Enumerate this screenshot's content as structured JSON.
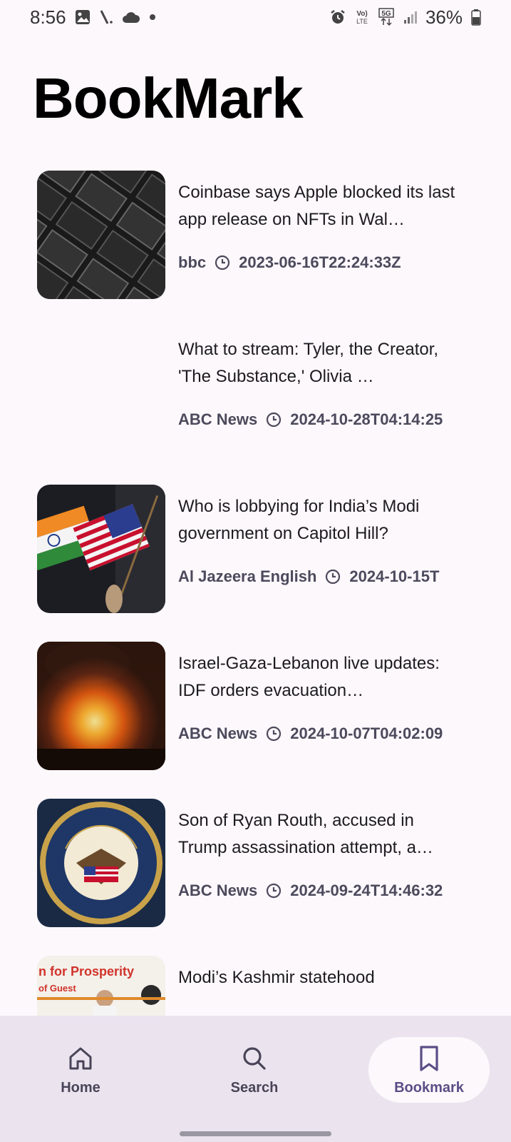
{
  "status_bar": {
    "time": "8:56",
    "battery": "36%",
    "left_icons": [
      "image-icon",
      "signal-slash-icon",
      "cloud-icon",
      "dot-icon"
    ],
    "right_icons": [
      "alarm-icon",
      "volte-icon",
      "5g-icon",
      "signal-icon",
      "battery-icon"
    ]
  },
  "page": {
    "title": "BookMark"
  },
  "articles": [
    {
      "title": "Coinbase says Apple blocked its last app release on NFTs in Wal…",
      "source": "bbc",
      "time": "2023-06-16T22:24:33Z",
      "has_image": true,
      "image": "apple-batteries"
    },
    {
      "title": "What to stream: Tyler, the Creator, 'The Substance,' Olivia …",
      "source": "ABC News",
      "time": "2024-10-28T04:14:25",
      "has_image": false
    },
    {
      "title": "Who is lobbying for India’s Modi government on Capitol Hill?",
      "source": "Al Jazeera English",
      "time": "2024-10-15T",
      "has_image": true,
      "image": "flags"
    },
    {
      "title": "Israel-Gaza-Lebanon live updates: IDF orders evacuation…",
      "source": "ABC News",
      "time": "2024-10-07T04:02:09",
      "has_image": true,
      "image": "explosion"
    },
    {
      "title": "Son of Ryan Routh, accused in Trump assassination attempt, a…",
      "source": "ABC News",
      "time": "2024-09-24T14:46:32",
      "has_image": true,
      "image": "doj-seal"
    },
    {
      "title": "Modi’s Kashmir statehood",
      "source": "",
      "time": "",
      "has_image": true,
      "image": "rally",
      "image_text_1": "n for Prosperity",
      "image_text_2": "of Guest"
    }
  ],
  "nav": {
    "items": [
      {
        "label": "Home",
        "icon": "home-icon",
        "active": false
      },
      {
        "label": "Search",
        "icon": "search-icon",
        "active": false
      },
      {
        "label": "Bookmark",
        "icon": "bookmark-icon",
        "active": true
      }
    ]
  },
  "colors": {
    "background": "#fdf8fc",
    "nav_background": "#ebe4ef",
    "accent": "#5a4e86",
    "meta_text": "#4c4a5c"
  }
}
